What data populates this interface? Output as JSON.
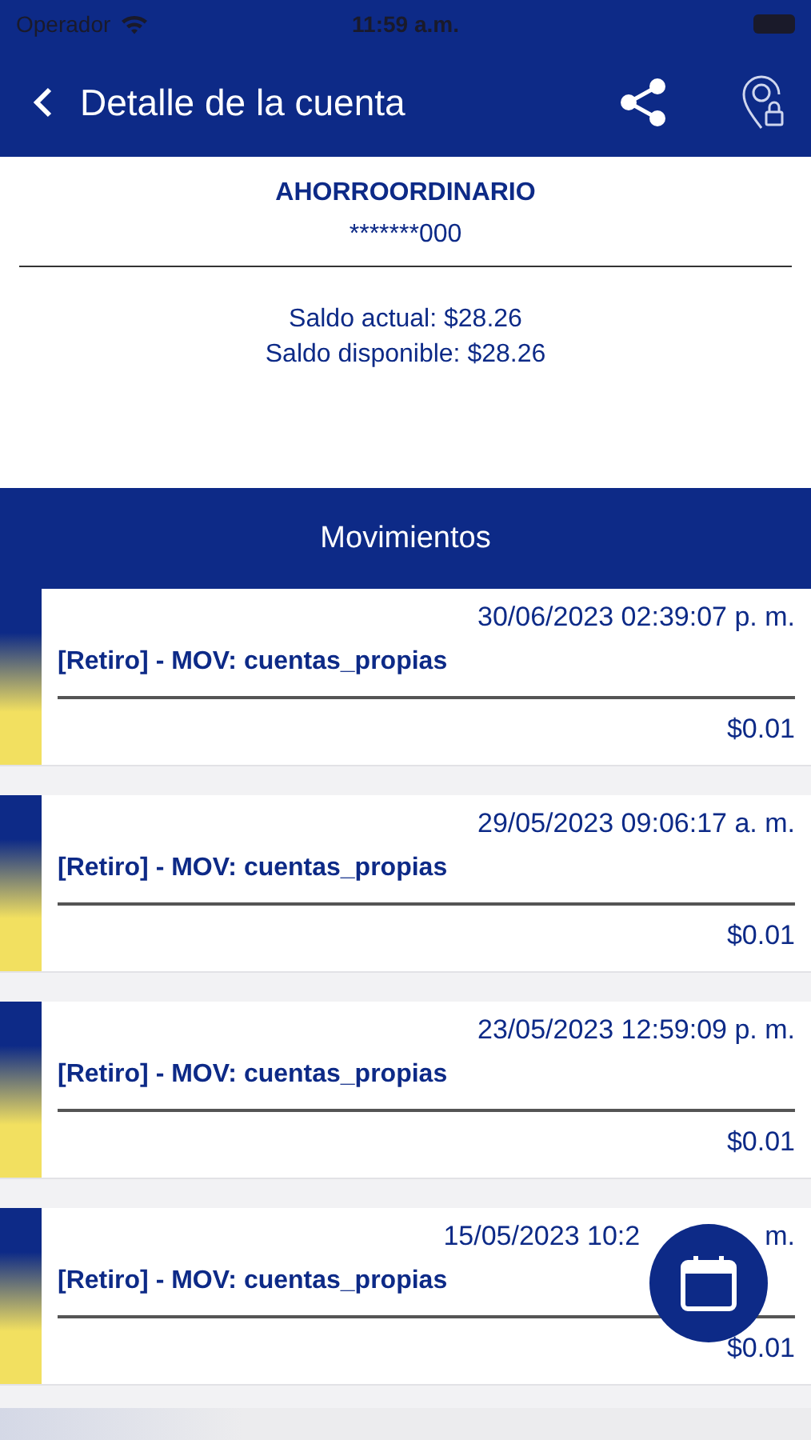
{
  "status_bar": {
    "carrier": "Operador",
    "time": "11:59 a.m."
  },
  "nav": {
    "title": "Detalle de la cuenta"
  },
  "account": {
    "type": "AHORROORDINARIO",
    "number": "*******000",
    "balances": [
      "Saldo actual: $28.26",
      "Saldo disponible: $28.26"
    ]
  },
  "movements": {
    "title": "Movimientos",
    "items": [
      {
        "date": "30/06/2023 02:39:07 p. m.",
        "description": "[Retiro] - MOV: cuentas_propias",
        "amount": "$0.01"
      },
      {
        "date": "29/05/2023 09:06:17 a. m.",
        "description": "[Retiro] - MOV: cuentas_propias",
        "amount": "$0.01"
      },
      {
        "date": "23/05/2023 12:59:09 p. m.",
        "description": "[Retiro] - MOV: cuentas_propias",
        "amount": "$0.01"
      },
      {
        "date": "15/05/2023 10:2",
        "date_end": "m.",
        "description": "[Retiro] - MOV: cuentas_propias",
        "amount": "$0.01"
      }
    ]
  }
}
